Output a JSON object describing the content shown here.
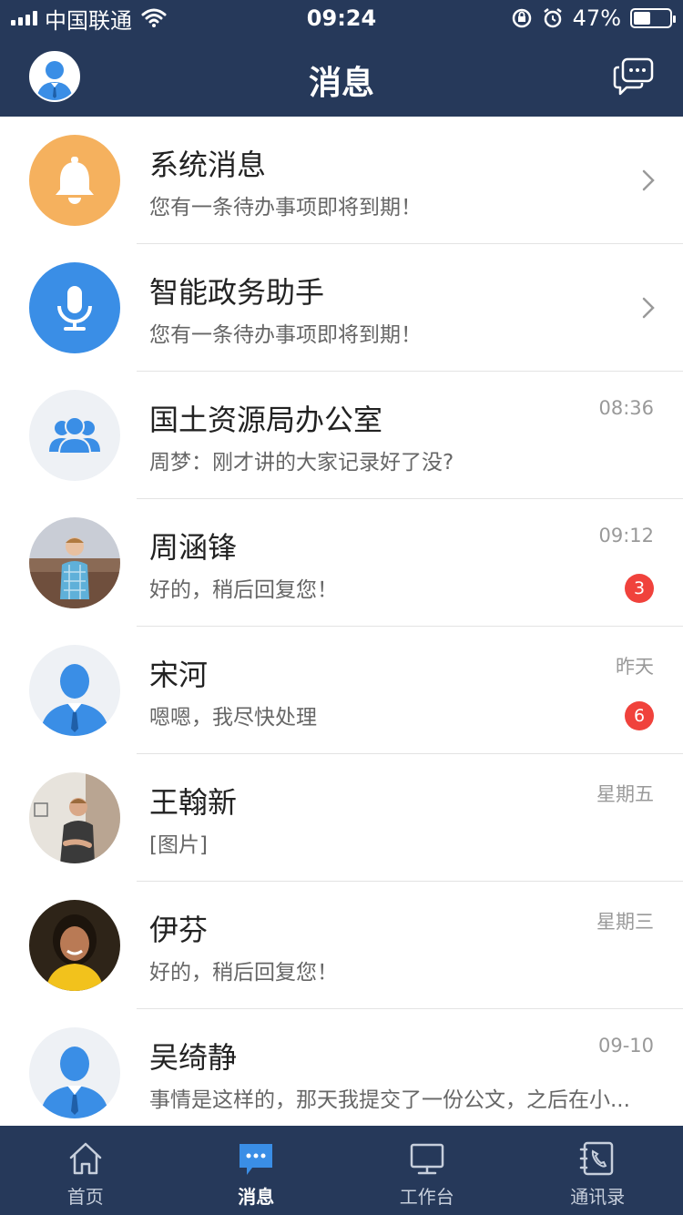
{
  "status_bar": {
    "carrier": "中国联通",
    "time": "09:24",
    "battery": "47%",
    "battery_level": 0.47
  },
  "header": {
    "title": "消息"
  },
  "messages": [
    {
      "title": "系统消息",
      "subtitle": "您有一条待办事项即将到期！",
      "time": "",
      "badge": "",
      "avatar_icon": "bell-icon",
      "avatar_color": "#f5b15e"
    },
    {
      "title": "智能政务助手",
      "subtitle": "您有一条待办事项即将到期！",
      "time": "",
      "badge": "",
      "avatar_icon": "microphone-icon",
      "avatar_color": "#3a8ee6"
    },
    {
      "title": "国土资源局办公室",
      "subtitle": "周梦：刚才讲的大家记录好了没?",
      "time": "08:36",
      "badge": "",
      "avatar_icon": "group-icon",
      "avatar_color": "#eef1f5"
    },
    {
      "title": "周涵锋",
      "subtitle": "好的，稍后回复您！",
      "time": "09:12",
      "badge": "3",
      "avatar_icon": "user-photo",
      "avatar_color": "#8a6a55"
    },
    {
      "title": "宋河",
      "subtitle": "嗯嗯，我尽快处理",
      "time": "昨天",
      "badge": "6",
      "avatar_icon": "default-user-icon",
      "avatar_color": "#eef1f5"
    },
    {
      "title": "王翰新",
      "subtitle": "[图片]",
      "time": "星期五",
      "badge": "",
      "avatar_icon": "user-photo",
      "avatar_color": "#b9a592"
    },
    {
      "title": "伊芬",
      "subtitle": "好的，稍后回复您！",
      "time": "星期三",
      "badge": "",
      "avatar_icon": "user-photo",
      "avatar_color": "#3b2a1a"
    },
    {
      "title": "吴绮静",
      "subtitle": "事情是这样的，那天我提交了一份公文，之后在小...",
      "time": "09-10",
      "badge": "",
      "avatar_icon": "default-user-icon",
      "avatar_color": "#eef1f5"
    }
  ],
  "tabs": [
    {
      "label": "首页",
      "icon": "home-icon"
    },
    {
      "label": "消息",
      "icon": "message-icon"
    },
    {
      "label": "工作台",
      "icon": "monitor-icon"
    },
    {
      "label": "通讯录",
      "icon": "contacts-icon"
    }
  ],
  "colors": {
    "bar_bg": "#26395a",
    "accent_blue": "#3a8ee6",
    "badge_red": "#f0423c"
  }
}
